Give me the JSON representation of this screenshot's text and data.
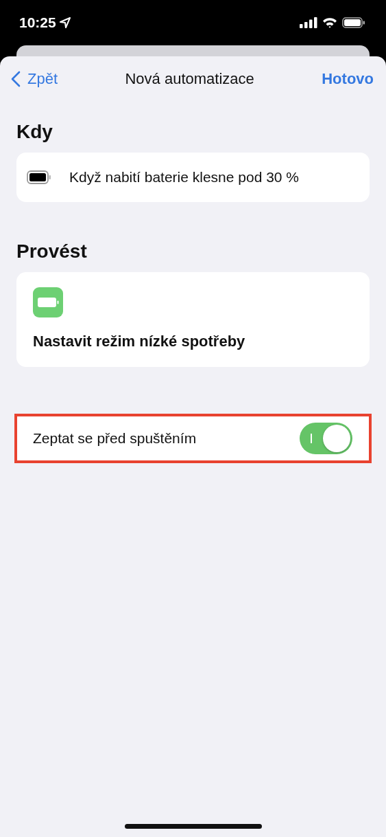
{
  "status_bar": {
    "time": "10:25"
  },
  "nav": {
    "back": "Zpět",
    "title": "Nová automatizace",
    "done": "Hotovo"
  },
  "sections": [
    {
      "heading": "Kdy",
      "kind": "trigger",
      "text": "Když nabití baterie klesne pod 30 %"
    },
    {
      "heading": "Provést",
      "kind": "action",
      "text": "Nastavit režim nízké spotřeby"
    }
  ],
  "setting": {
    "label": "Zeptat se před spuštěním",
    "on": true,
    "highlighted": true
  }
}
